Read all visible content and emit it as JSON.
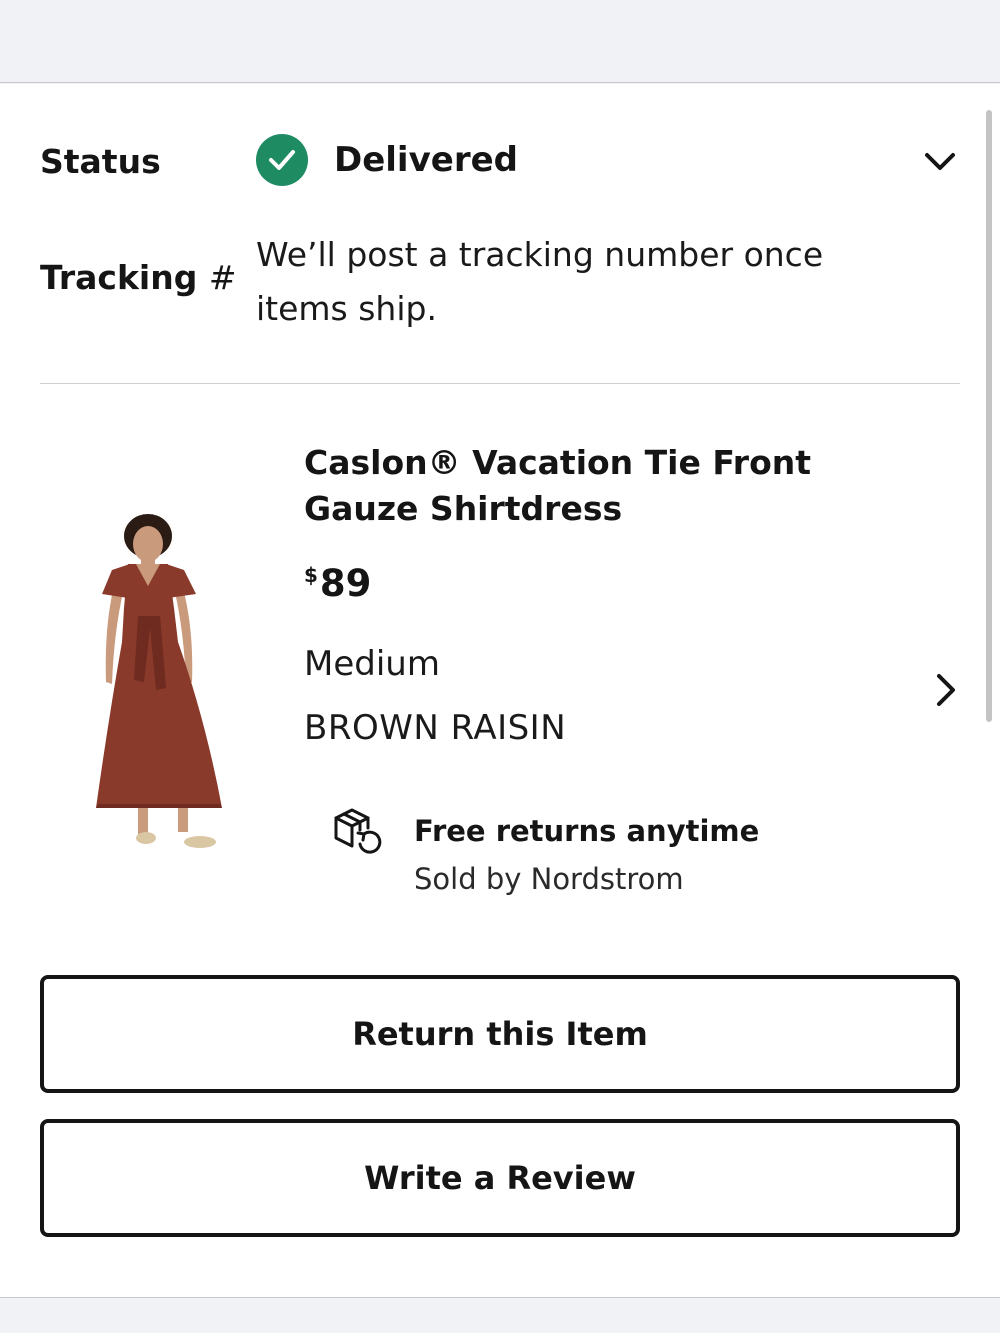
{
  "order_item": {
    "status_label": "Status",
    "status_value": "Delivered",
    "tracking_label": "Tracking",
    "tracking_hash": "#",
    "tracking_text": "We’ll post a tracking number once items ship."
  },
  "product": {
    "name": "Caslon® Vacation Tie Front Gauze Shirtdress",
    "price_currency": "$",
    "price_amount": "89",
    "size": "Medium",
    "color": "BROWN RAISIN",
    "image_icon": "dress-product-photo"
  },
  "returns": {
    "title": "Free returns anytime",
    "sold_by": "Sold by Nordstrom",
    "icon": "box-return-icon"
  },
  "actions": {
    "return_label": "Return this Item",
    "review_label": "Write a Review"
  },
  "colors": {
    "status_green": "#1e8b63",
    "dress_brown": "#8a3a2b",
    "text": "#151515",
    "page_bg": "#f1f2f6"
  }
}
